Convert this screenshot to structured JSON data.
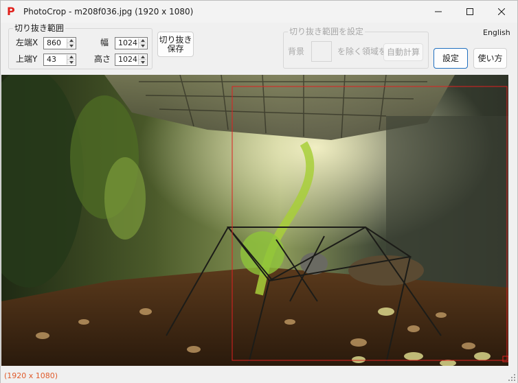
{
  "app": {
    "icon_letter": "P",
    "title": "PhotoCrop - m208f036.jpg (1920 x 1080)"
  },
  "crop_group": {
    "legend": "切り抜き範囲",
    "left_label": "左端X",
    "left_value": "860",
    "top_label": "上端Y",
    "top_value": "43",
    "width_label": "幅",
    "width_value": "1024",
    "height_label": "高さ",
    "height_value": "1024"
  },
  "toolbar": {
    "save_line1": "切り抜き",
    "save_line2": "保存",
    "settings_label": "設定",
    "howto_label": "使い方",
    "language_link": "English"
  },
  "auto_group": {
    "legend": "切り抜き範囲を設定",
    "bg_label": "背景",
    "exclude_label": "を除く領域を",
    "auto_button": "自動計算"
  },
  "status": {
    "text": "(1920 x 1080)"
  },
  "colors": {
    "accent": "#1f6fbf",
    "app_icon": "#e0201b",
    "crop_rect": "#e02020",
    "status_text": "#e05a2a"
  },
  "icons": {
    "app": "letter-p-icon",
    "minimize": "minimize-icon",
    "maximize": "maximize-icon",
    "close": "close-icon"
  }
}
